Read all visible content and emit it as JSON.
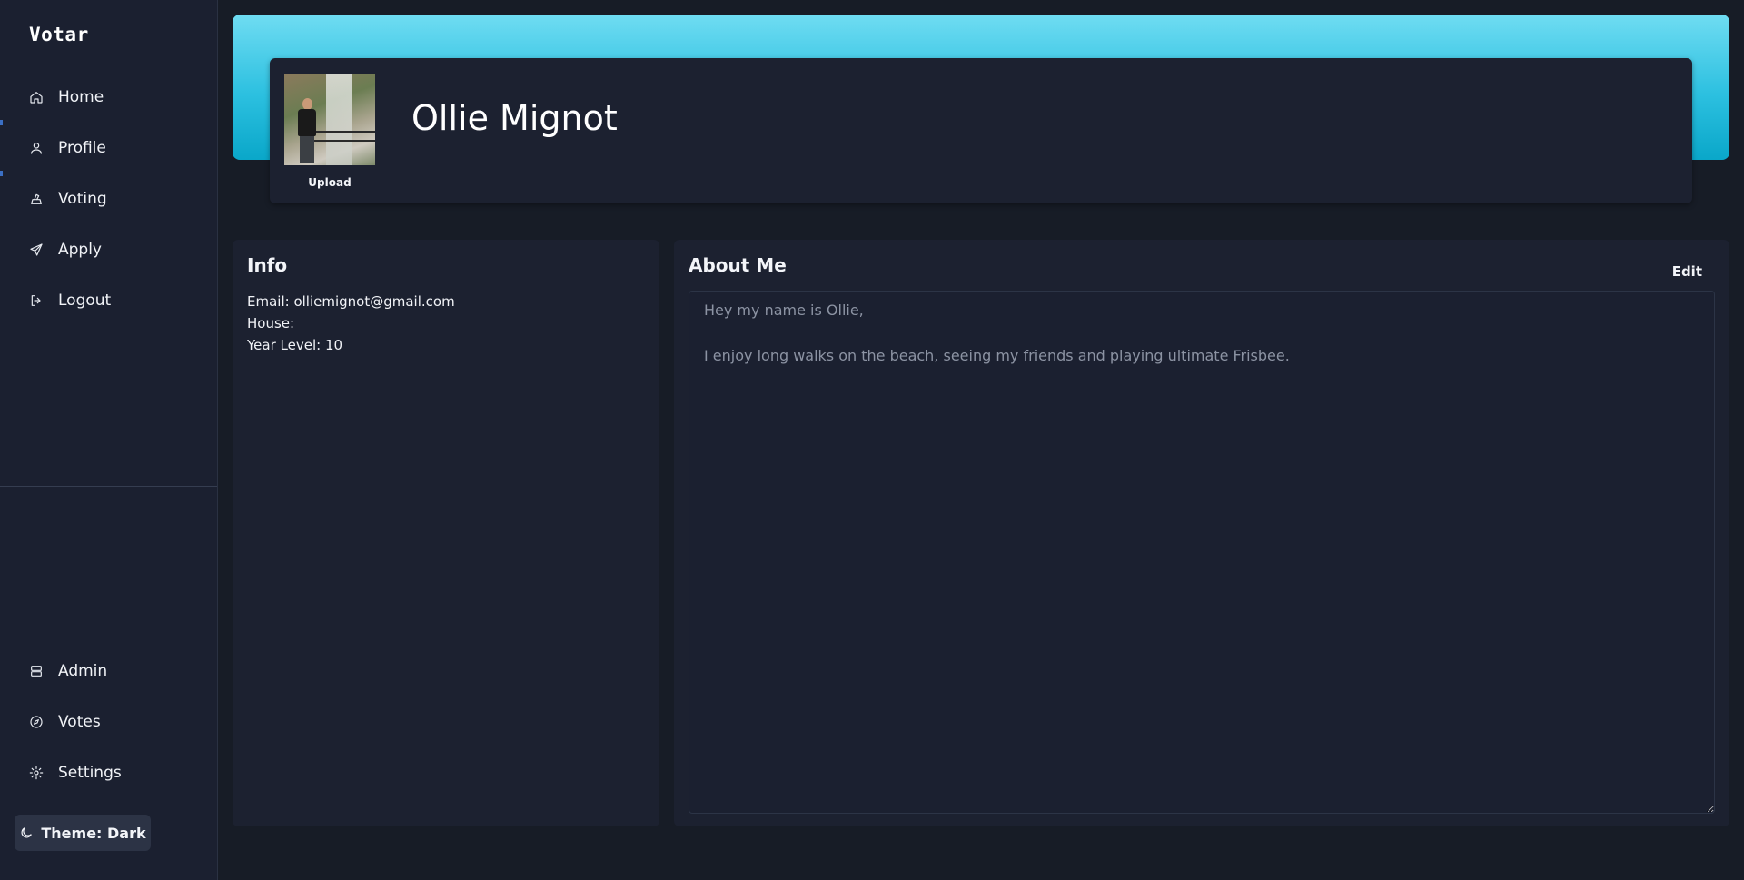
{
  "app": {
    "brand": "Votar"
  },
  "sidebar": {
    "items": [
      {
        "label": "Home",
        "icon": "home-icon"
      },
      {
        "label": "Profile",
        "icon": "user-icon"
      },
      {
        "label": "Voting",
        "icon": "ballot-icon"
      },
      {
        "label": "Apply",
        "icon": "send-icon"
      },
      {
        "label": "Logout",
        "icon": "logout-icon"
      }
    ],
    "bottom_items": [
      {
        "label": "Admin",
        "icon": "server-icon"
      },
      {
        "label": "Votes",
        "icon": "compass-icon"
      },
      {
        "label": "Settings",
        "icon": "gear-icon"
      }
    ],
    "theme_button": {
      "label": "Theme: Dark",
      "icon": "moon-icon"
    }
  },
  "profile": {
    "name": "Ollie Mignot",
    "upload_label": "Upload"
  },
  "info": {
    "title": "Info",
    "email": "Email: olliemignot@gmail.com",
    "house": "House:",
    "year_level": "Year Level: 10"
  },
  "about": {
    "title": "About Me",
    "edit_label": "Edit",
    "text": "Hey my name is Ollie,\n\nI enjoy long walks on the beach, seeing my friends and playing ultimate Frisbee."
  },
  "colors": {
    "banner_top": "#6fdcf2",
    "banner_bottom": "#0aa7c9",
    "background": "#171c26",
    "panel": "#1c2130",
    "active_indicator": "#3b6fc4"
  }
}
